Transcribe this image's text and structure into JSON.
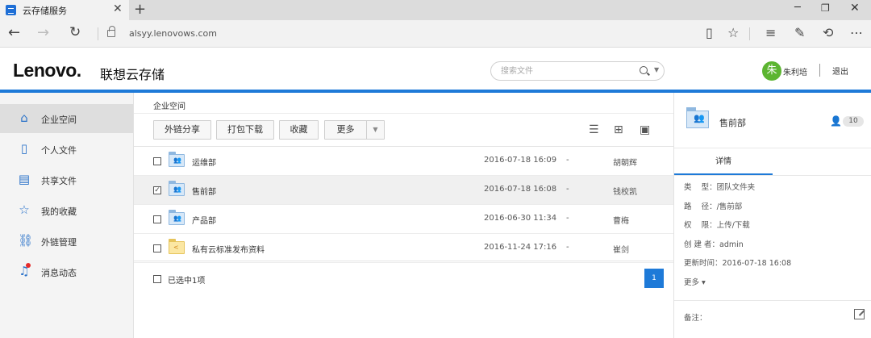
{
  "browser": {
    "tab_title": "云存储服务",
    "tab_close": "✕",
    "new_tab": "+",
    "url": "alsyy.lenovows.com",
    "window": {
      "minimize": "─",
      "maximize": "❐",
      "close": "✕"
    },
    "nav": {
      "back": "←",
      "forward": "→",
      "refresh": "↻"
    },
    "toolbar_icons": [
      "reading-view-icon",
      "favorite-star-icon",
      "hub-icon",
      "web-note-icon",
      "share-icon",
      "more-icon"
    ]
  },
  "header": {
    "logo": "Lenovo.",
    "logo_cn": "联想云存储",
    "search": {
      "placeholder": "搜索文件"
    },
    "user": {
      "avatar_char": "朱",
      "avatar_color": "#5cb531",
      "name": "朱利培"
    },
    "logout": "退出",
    "accent_color": "#1e7ad8"
  },
  "sidebar": {
    "items": [
      {
        "label": "企业空间",
        "icon": "home-icon",
        "active": true
      },
      {
        "label": "个人文件",
        "icon": "document-icon",
        "active": false
      },
      {
        "label": "共享文件",
        "icon": "shared-folder-icon",
        "active": false
      },
      {
        "label": "我的收藏",
        "icon": "star-icon",
        "active": false
      },
      {
        "label": "外链管理",
        "icon": "link-icon",
        "active": false
      },
      {
        "label": "消息动态",
        "icon": "bell-icon",
        "active": false,
        "badge": true
      }
    ]
  },
  "main": {
    "breadcrumb": "企业空间",
    "toolbar": {
      "share_link": "外链分享",
      "pack_download": "打包下载",
      "favorite": "收藏",
      "more": "更多"
    },
    "rows": [
      {
        "name": "运维部",
        "date": "2016-07-18 16:09",
        "size": "-",
        "owner": "胡朝辉",
        "type": "team-folder",
        "checked": false
      },
      {
        "name": "售前部",
        "date": "2016-07-18 16:08",
        "size": "-",
        "owner": "钱校凯",
        "type": "team-folder",
        "checked": true
      },
      {
        "name": "产品部",
        "date": "2016-06-30 11:34",
        "size": "-",
        "owner": "曹梅",
        "type": "team-folder",
        "checked": false
      },
      {
        "name": "私有云标准发布资料",
        "date": "2016-11-24 17:16",
        "size": "-",
        "owner": "崔剑",
        "type": "shared-folder",
        "checked": false
      }
    ],
    "footer": {
      "selected_text": "已选中1项",
      "current_page": "1"
    }
  },
  "detail": {
    "title": "售前部",
    "member_count": "10",
    "tab": "详情",
    "props": [
      "类    型：团队文件夹",
      "路    径：/售前部",
      "权    限：上传/下载",
      "创 建 者：admin",
      "更新时间：2016-07-18 16:08"
    ],
    "more": "更多 ▾",
    "note_label": "备注："
  }
}
